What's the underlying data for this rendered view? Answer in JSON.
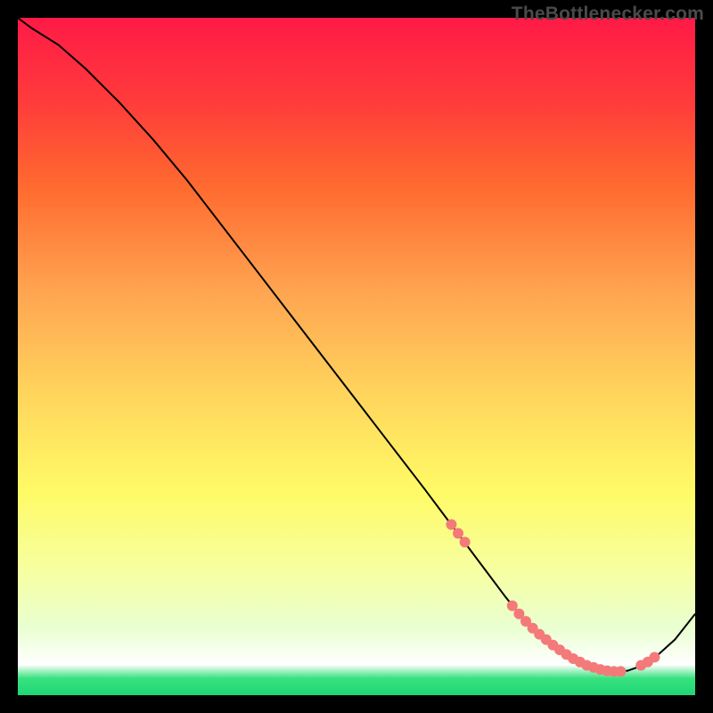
{
  "watermark": "TheBottlenecker.com",
  "chart_data": {
    "type": "line",
    "title": "",
    "xlabel": "",
    "ylabel": "",
    "xlim": [
      0,
      100
    ],
    "ylim": [
      0,
      100
    ],
    "grid": false,
    "gradient_stops": [
      {
        "t": 0.0,
        "color": "#ff1a47"
      },
      {
        "t": 0.12,
        "color": "#ff3a3b"
      },
      {
        "t": 0.25,
        "color": "#ff6a2f"
      },
      {
        "t": 0.4,
        "color": "#ffa350"
      },
      {
        "t": 0.55,
        "color": "#ffd35c"
      },
      {
        "t": 0.7,
        "color": "#fffb66"
      },
      {
        "t": 0.82,
        "color": "#f6ffa3"
      },
      {
        "t": 0.9,
        "color": "#e9ffd0"
      },
      {
        "t": 0.955,
        "color": "#ffffff"
      },
      {
        "t": 0.975,
        "color": "#38e27e"
      },
      {
        "t": 1.0,
        "color": "#1ed676"
      }
    ],
    "series": [
      {
        "name": "curve",
        "color": "#000000",
        "width": 2,
        "x": [
          0,
          2,
          6,
          10,
          15,
          20,
          25,
          30,
          35,
          40,
          45,
          50,
          55,
          60,
          63,
          66,
          69,
          72,
          74,
          76,
          78,
          80,
          82,
          84,
          86,
          88,
          90,
          92,
          94,
          97,
          100
        ],
        "y": [
          100,
          98.5,
          96,
          92.5,
          87.5,
          82,
          76,
          69.5,
          63,
          56.5,
          50,
          43.5,
          37,
          30.5,
          26.5,
          22.5,
          18.5,
          14.5,
          12,
          10,
          8.2,
          6.7,
          5.4,
          4.4,
          3.8,
          3.5,
          3.6,
          4.3,
          5.5,
          8.2,
          12
        ]
      }
    ],
    "markers": {
      "color": "#f47a7a",
      "radius": 6,
      "points": [
        {
          "x": 64,
          "y": 25.2
        },
        {
          "x": 65,
          "y": 23.9
        },
        {
          "x": 66,
          "y": 22.6
        },
        {
          "x": 73,
          "y": 13.2
        },
        {
          "x": 74,
          "y": 12.0
        },
        {
          "x": 75,
          "y": 10.9
        },
        {
          "x": 76,
          "y": 9.9
        },
        {
          "x": 77,
          "y": 9.0
        },
        {
          "x": 78,
          "y": 8.2
        },
        {
          "x": 79,
          "y": 7.4
        },
        {
          "x": 80,
          "y": 6.7
        },
        {
          "x": 81,
          "y": 6.0
        },
        {
          "x": 82,
          "y": 5.4
        },
        {
          "x": 83,
          "y": 4.9
        },
        {
          "x": 84,
          "y": 4.4
        },
        {
          "x": 85,
          "y": 4.1
        },
        {
          "x": 86,
          "y": 3.8
        },
        {
          "x": 87,
          "y": 3.6
        },
        {
          "x": 88,
          "y": 3.5
        },
        {
          "x": 89,
          "y": 3.5
        },
        {
          "x": 92,
          "y": 4.4
        },
        {
          "x": 93,
          "y": 4.9
        },
        {
          "x": 94,
          "y": 5.6
        }
      ]
    }
  }
}
